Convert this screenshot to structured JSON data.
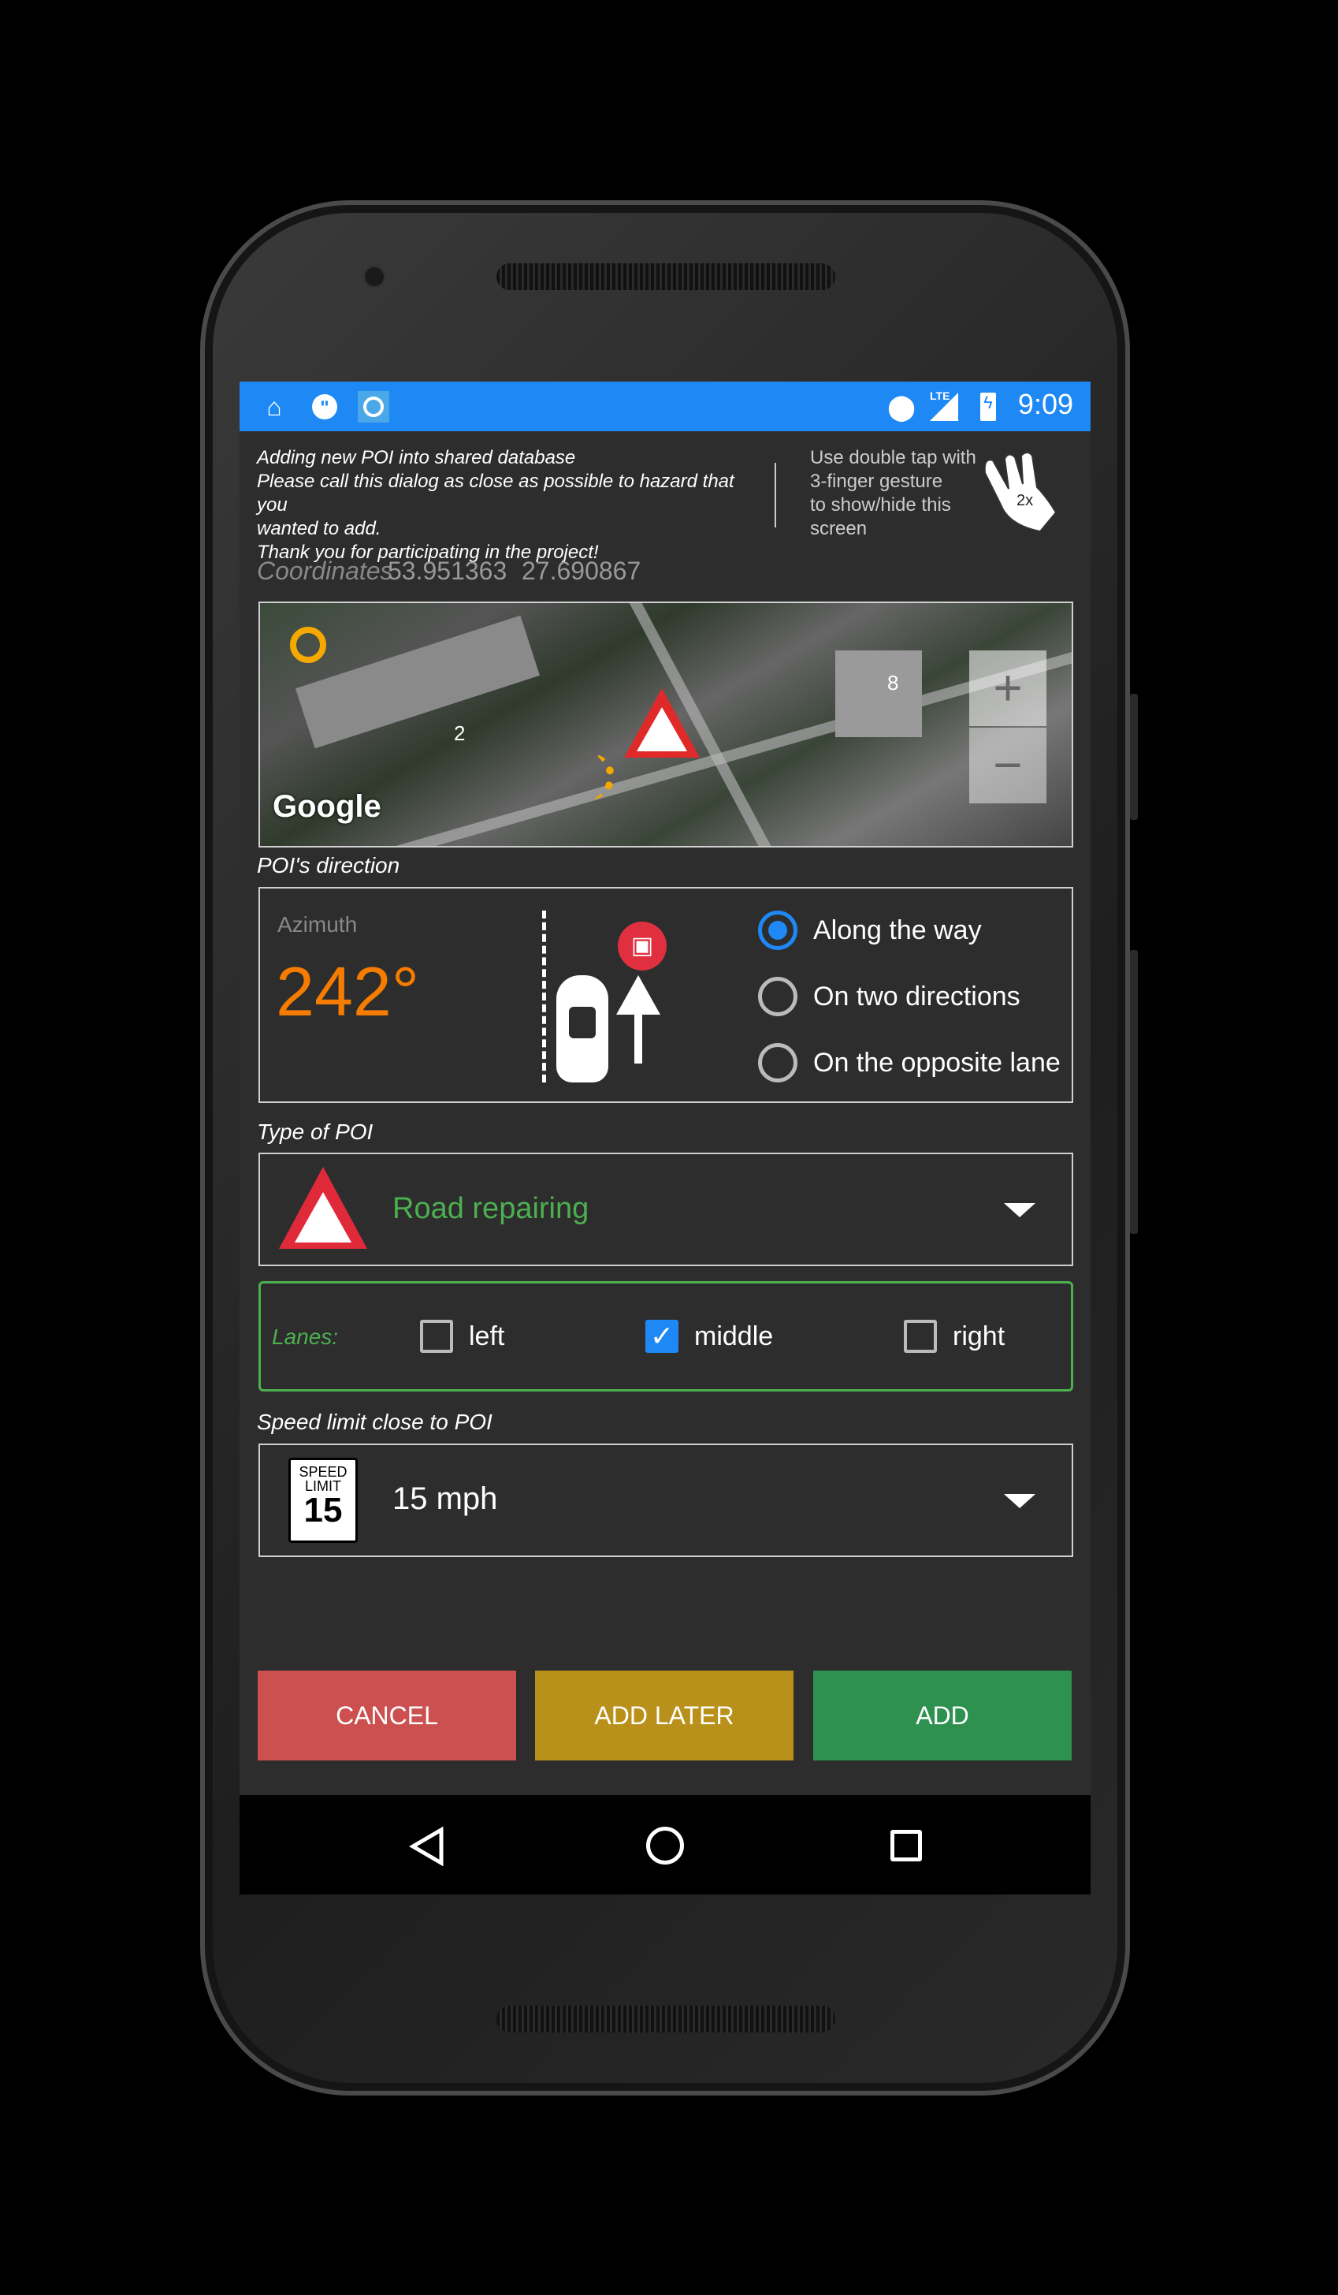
{
  "status_bar": {
    "time": "9:09",
    "network": "LTE",
    "left_icons": [
      "cleaning-icon",
      "hangouts-icon",
      "gps-target-icon"
    ],
    "right_icons": [
      "location-pin-icon",
      "signal-icon",
      "battery-charging-icon"
    ]
  },
  "header": {
    "info_lines": [
      "Adding new POI into shared database",
      "Please call this dialog as close as possible to hazard that you",
      "wanted to add.",
      "Thank you for participating in the project!"
    ],
    "hint_lines": [
      "Use double tap with",
      "3-finger gesture",
      "to show/hide this",
      "screen"
    ],
    "gesture_badge": "2x"
  },
  "coordinates": {
    "label": "Coordinates",
    "lat": "53.951363",
    "lon": "27.690867"
  },
  "map": {
    "logo": "Google",
    "markers": [
      "2",
      "8"
    ],
    "zoom_in": "+",
    "zoom_out": "−"
  },
  "direction": {
    "section_label": "POI's direction",
    "azimuth_label": "Azimuth",
    "azimuth_value": "242°",
    "options": [
      {
        "label": "Along the way",
        "selected": true
      },
      {
        "label": "On two directions",
        "selected": false
      },
      {
        "label": "On the opposite lane",
        "selected": false
      }
    ]
  },
  "poi_type": {
    "section_label": "Type of POI",
    "value": "Road repairing"
  },
  "lanes": {
    "label": "Lanes:",
    "options": [
      {
        "label": "left",
        "checked": false
      },
      {
        "label": "middle",
        "checked": true
      },
      {
        "label": "right",
        "checked": false
      }
    ]
  },
  "speed": {
    "section_label": "Speed limit close to POI",
    "sign_top": "SPEED",
    "sign_mid": "LIMIT",
    "sign_num": "15",
    "value": "15 mph"
  },
  "buttons": {
    "cancel": "CANCEL",
    "add_later": "ADD LATER",
    "add": "ADD"
  },
  "colors": {
    "accent": "#1e88f5",
    "azimuth": "#f57c00",
    "poi_type": "#4caf50",
    "cancel": "#cc5050",
    "add_later": "#b8901a",
    "add": "#2e9150"
  }
}
